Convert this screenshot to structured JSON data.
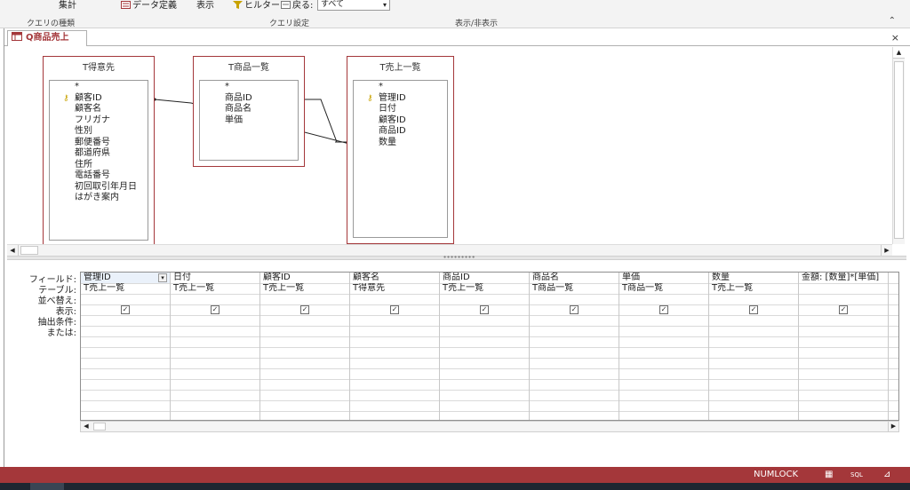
{
  "ribbon": {
    "totals": "集計",
    "data_definition": "データ定義",
    "show": "表示",
    "filter": "ヒルター",
    "return": "戻る:",
    "return_value": "すべて",
    "group_query_type": "クエリの種類",
    "group_query_setup": "クエリ設定",
    "group_show_hide": "表示/非表示"
  },
  "tab": {
    "label": "Q商品売上"
  },
  "tables": [
    {
      "title": "T得意先",
      "fields": [
        "*",
        "顧客ID",
        "顧客名",
        "フリガナ",
        "性別",
        "郵便番号",
        "都道府県",
        "住所",
        "電話番号",
        "初回取引年月日",
        "はがき案内"
      ],
      "key_field": "顧客ID"
    },
    {
      "title": "T商品一覧",
      "fields": [
        "*",
        "商品ID",
        "商品名",
        "単価"
      ],
      "key_field": ""
    },
    {
      "title": "T売上一覧",
      "fields": [
        "*",
        "管理ID",
        "日付",
        "顧客ID",
        "商品ID",
        "数量"
      ],
      "key_field": "管理ID"
    }
  ],
  "grid": {
    "row_labels": [
      "フィールド:",
      "テーブル:",
      "並べ替え:",
      "表示:",
      "抽出条件:",
      "または:"
    ],
    "columns": [
      {
        "field": "管理ID",
        "table": "T売上一覧",
        "show": true
      },
      {
        "field": "日付",
        "table": "T売上一覧",
        "show": true
      },
      {
        "field": "顧客ID",
        "table": "T売上一覧",
        "show": true
      },
      {
        "field": "顧客名",
        "table": "T得意先",
        "show": true
      },
      {
        "field": "商品ID",
        "table": "T売上一覧",
        "show": true
      },
      {
        "field": "商品名",
        "table": "T商品一覧",
        "show": true
      },
      {
        "field": "単価",
        "table": "T商品一覧",
        "show": true
      },
      {
        "field": "数量",
        "table": "T売上一覧",
        "show": true
      },
      {
        "field": "金額: [数量]*[単価]",
        "table": "",
        "show": true
      }
    ]
  },
  "status": {
    "numlock": "NUMLOCK",
    "sql_label": "SQL"
  },
  "colors": {
    "accent": "#a4373a",
    "key": "#c8a200"
  }
}
